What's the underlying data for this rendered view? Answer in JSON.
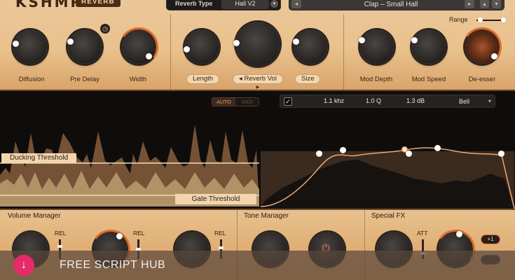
{
  "header": {
    "brand": "KSHMR",
    "brand_badge": "REVERB",
    "reverb_type_label": "Reverb Type",
    "reverb_type_value": "Hall V2",
    "preset_name": "Clap – Small Hall",
    "range_label": "Range"
  },
  "top_knobs": {
    "diffusion": "Diffusion",
    "pre_delay": "Pre Delay",
    "width": "Width",
    "length": "Length",
    "reverb_vol": "◂ Reverb Vol ▸",
    "size": "Size",
    "mod_depth": "Mod Depth",
    "mod_speed": "Mod Speed",
    "de_esser": "De-esser"
  },
  "automation": {
    "auto": "AUTO",
    "midi": "MIDI"
  },
  "eq": {
    "enabled": true,
    "frequency": "1.1 khz",
    "q": "1.0 Q",
    "gain": "1.3 dB",
    "type": "Bell"
  },
  "thresholds": {
    "ducking": "Ducking Threshold",
    "gate": "Gate Threshold"
  },
  "bottom": {
    "volume_manager": "Volume Manager",
    "tone_manager": "Tone Manager",
    "special_fx": "Special FX",
    "rel": "REL",
    "att": "ATT",
    "plus_one": "+1"
  },
  "watermark": {
    "text": "FREE SCRIPT HUB"
  },
  "colors": {
    "accent": "#e06d2a",
    "panel": "#e9c18c",
    "dark": "#0f0d0c",
    "banner_icon": "#e52b6c"
  }
}
